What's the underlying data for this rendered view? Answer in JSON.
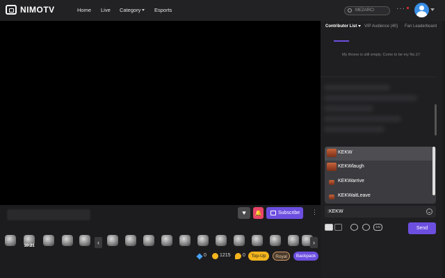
{
  "header": {
    "logo_text": "NIMOTV",
    "nav": [
      {
        "label": "Home"
      },
      {
        "label": "Live"
      },
      {
        "label": "Category"
      },
      {
        "label": "Esports"
      }
    ],
    "search_placeholder": "MEZARCI",
    "more": "···"
  },
  "player": {
    "subscribe_label": "Subscribe",
    "heart_icon": "heart-icon",
    "bell_icon": "bell-icon",
    "more": "⋮"
  },
  "gifts": {
    "items": [
      {
        "name": "gift-0"
      },
      {
        "name": "gift-1",
        "label": "10:21"
      },
      {
        "name": "gift-2"
      },
      {
        "name": "gift-3"
      },
      {
        "name": "gift-4"
      },
      {
        "name": "gift-5"
      },
      {
        "name": "gift-6"
      },
      {
        "name": "gift-7"
      },
      {
        "name": "gift-8"
      },
      {
        "name": "gift-9"
      },
      {
        "name": "gift-10"
      },
      {
        "name": "gift-11"
      },
      {
        "name": "gift-12"
      },
      {
        "name": "gift-13"
      },
      {
        "name": "gift-14"
      },
      {
        "name": "gift-15"
      },
      {
        "name": "gift-16"
      },
      {
        "name": "gift-17"
      }
    ],
    "prev": "‹",
    "next": "›"
  },
  "wallet": {
    "diamonds": "0",
    "coins": "1215",
    "gems": "0",
    "topup_label": "Top-Up",
    "royal_label": "Royal",
    "backpack_label": "Backpack"
  },
  "sidebar": {
    "tabs": [
      {
        "label": "Contributor List"
      },
      {
        "label": "VIP Audience (40)"
      },
      {
        "label": "Fan Leaderboard"
      }
    ],
    "empty_message": "My throne is still empty. Come to be my No.1!!"
  },
  "emotes": {
    "items": [
      {
        "name": "KEKW"
      },
      {
        "name": "KEKWlaugh"
      },
      {
        "name": "KEKWarrive"
      },
      {
        "name": "KEKWaitLeave"
      }
    ]
  },
  "chat": {
    "input_value": ":KEKW",
    "send_label": "Send",
    "badge_tool": "1W"
  },
  "colors": {
    "accent": "#6c4fe0",
    "bell": "#e84466",
    "topup": "#f3b51d",
    "royal": "#d19a66"
  }
}
